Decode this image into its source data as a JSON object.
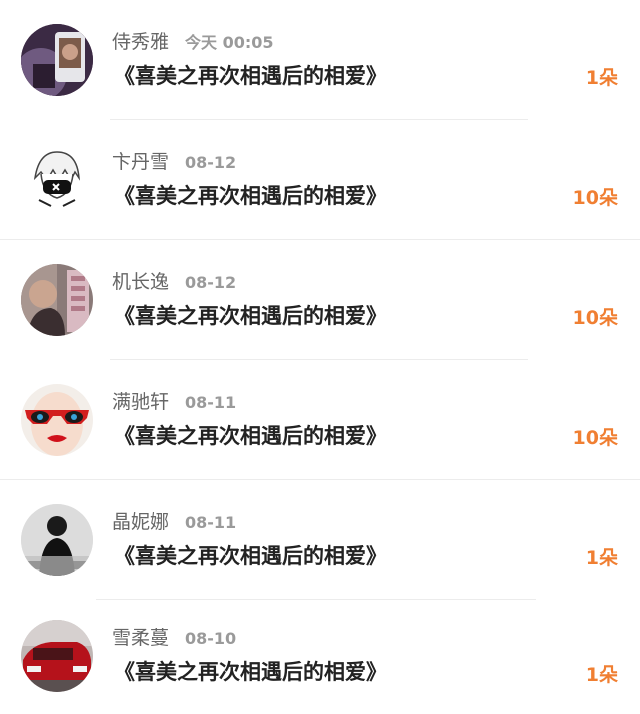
{
  "gifts": [
    {
      "user": "侍秀雅",
      "time": "今天 00:05",
      "title": "《喜美之再次相遇后的相爱》",
      "amount": "1朵",
      "avatar_icon": "avatar-photo-dark"
    },
    {
      "user": "卞丹雪",
      "time": "08-12",
      "title": "《喜美之再次相遇后的相爱》",
      "amount": "10朵",
      "avatar_icon": "avatar-anime-masked"
    },
    {
      "user": "机长逸",
      "time": "08-12",
      "title": "《喜美之再次相遇后的相爱》",
      "amount": "10朵",
      "avatar_icon": "avatar-photo-pink"
    },
    {
      "user": "满驰轩",
      "time": "08-11",
      "title": "《喜美之再次相遇后的相爱》",
      "amount": "10朵",
      "avatar_icon": "avatar-red-sunglasses"
    },
    {
      "user": "晶妮娜",
      "time": "08-11",
      "title": "《喜美之再次相遇后的相爱》",
      "amount": "1朵",
      "avatar_icon": "avatar-photo-bw"
    },
    {
      "user": "雪柔蔓",
      "time": "08-10",
      "title": "《喜美之再次相遇后的相爱》",
      "amount": "1朵",
      "avatar_icon": "avatar-red-car"
    }
  ],
  "colors": {
    "amount": "#f07f32",
    "name": "#666666",
    "time": "#9a9a9a",
    "title": "#222222",
    "divider": "#ececec"
  }
}
